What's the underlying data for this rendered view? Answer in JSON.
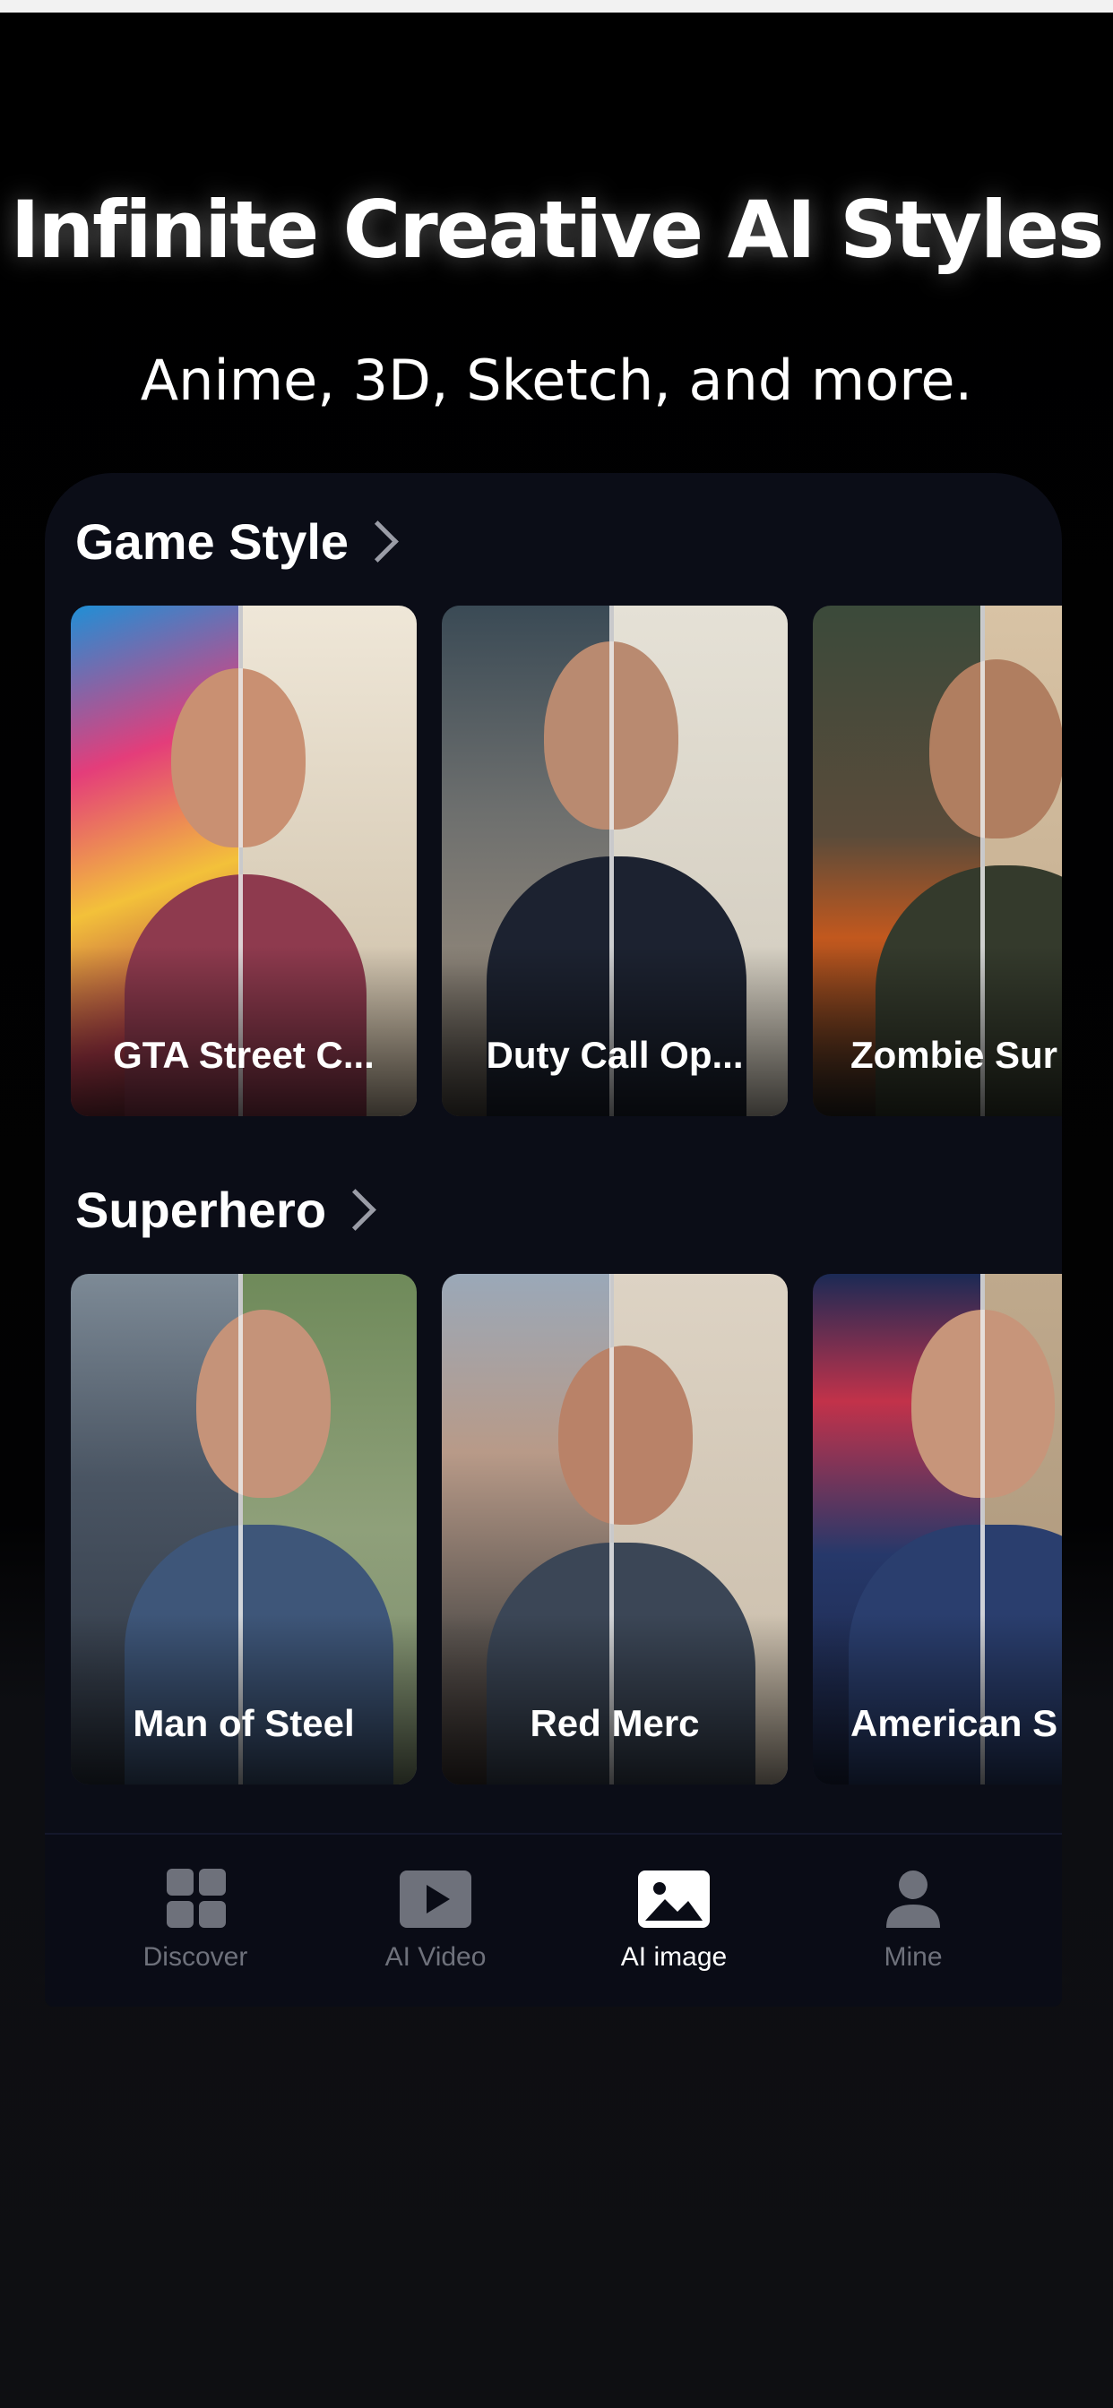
{
  "promo": {
    "headline": "Infinite Creative AI Styles",
    "subline": "Anime, 3D, Sketch, and more."
  },
  "sections": [
    {
      "title": "Game Style",
      "cards": [
        {
          "label": "GTA Street C..."
        },
        {
          "label": "Duty Call Op..."
        },
        {
          "label": "Zombie Sur"
        }
      ]
    },
    {
      "title": "Superhero",
      "cards": [
        {
          "label": "Man of Steel"
        },
        {
          "label": "Red Merc"
        },
        {
          "label": "American S"
        }
      ]
    }
  ],
  "tabbar": {
    "items": [
      {
        "label": "Discover",
        "icon": "grid-icon",
        "active": false
      },
      {
        "label": "AI Video",
        "icon": "play-icon",
        "active": false
      },
      {
        "label": "AI image",
        "icon": "image-icon",
        "active": true
      },
      {
        "label": "Mine",
        "icon": "person-icon",
        "active": false
      }
    ]
  },
  "colors": {
    "background": "#000000",
    "panel": "#0b0d17",
    "active_tab": "#ffffff",
    "inactive_tab": "#6e717b"
  }
}
